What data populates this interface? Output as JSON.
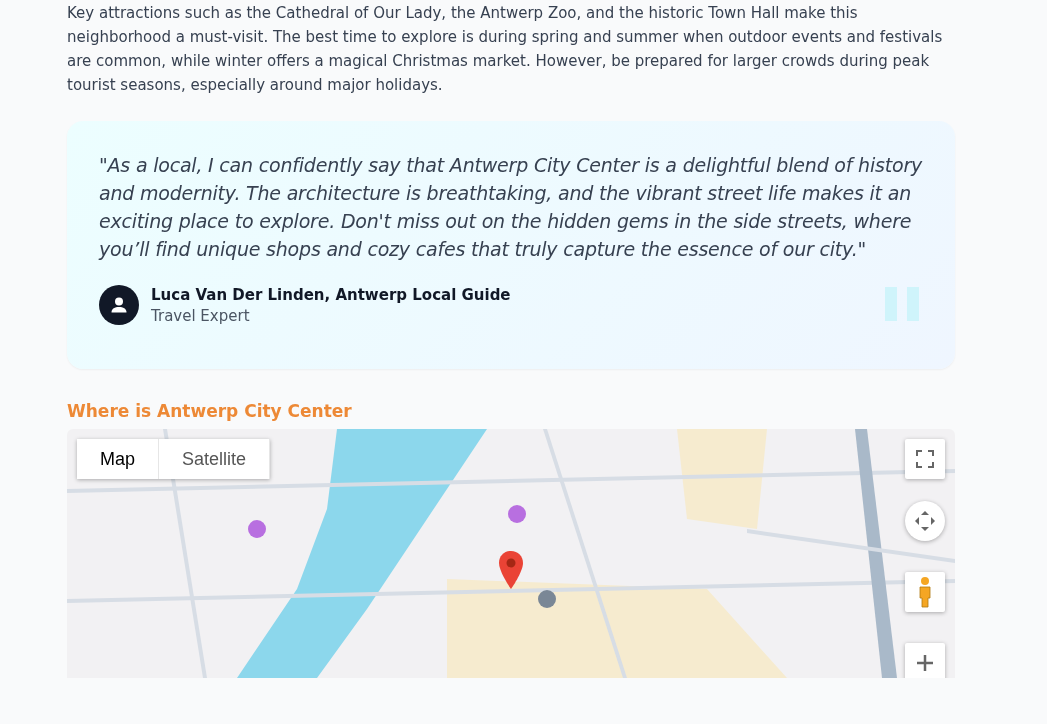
{
  "intro": "Key attractions such as the Cathedral of Our Lady, the Antwerp Zoo, and the historic Town Hall make this neighborhood a must-visit. The best time to explore is during spring and summer when outdoor events and festivals are common, while winter offers a magical Christmas market. However, be prepared for larger crowds during peak tourist seasons, especially around major holidays.",
  "testimonial": {
    "quote": "\"As a local, I can confidently say that Antwerp City Center is a delightful blend of history and modernity. The architecture is breathtaking, and the vibrant street life makes it an exciting place to explore. Don't miss out on the hidden gems in the side streets, where you’ll find unique shops and cozy cafes that truly capture the essence of our city.\"",
    "author": "Luca Van Der Linden, Antwerp Local Guide",
    "role": "Travel Expert"
  },
  "map_section": {
    "heading": "Where is Antwerp City Center",
    "map_types": [
      {
        "label": "Map",
        "selected": true
      },
      {
        "label": "Satellite",
        "selected": false
      }
    ]
  }
}
